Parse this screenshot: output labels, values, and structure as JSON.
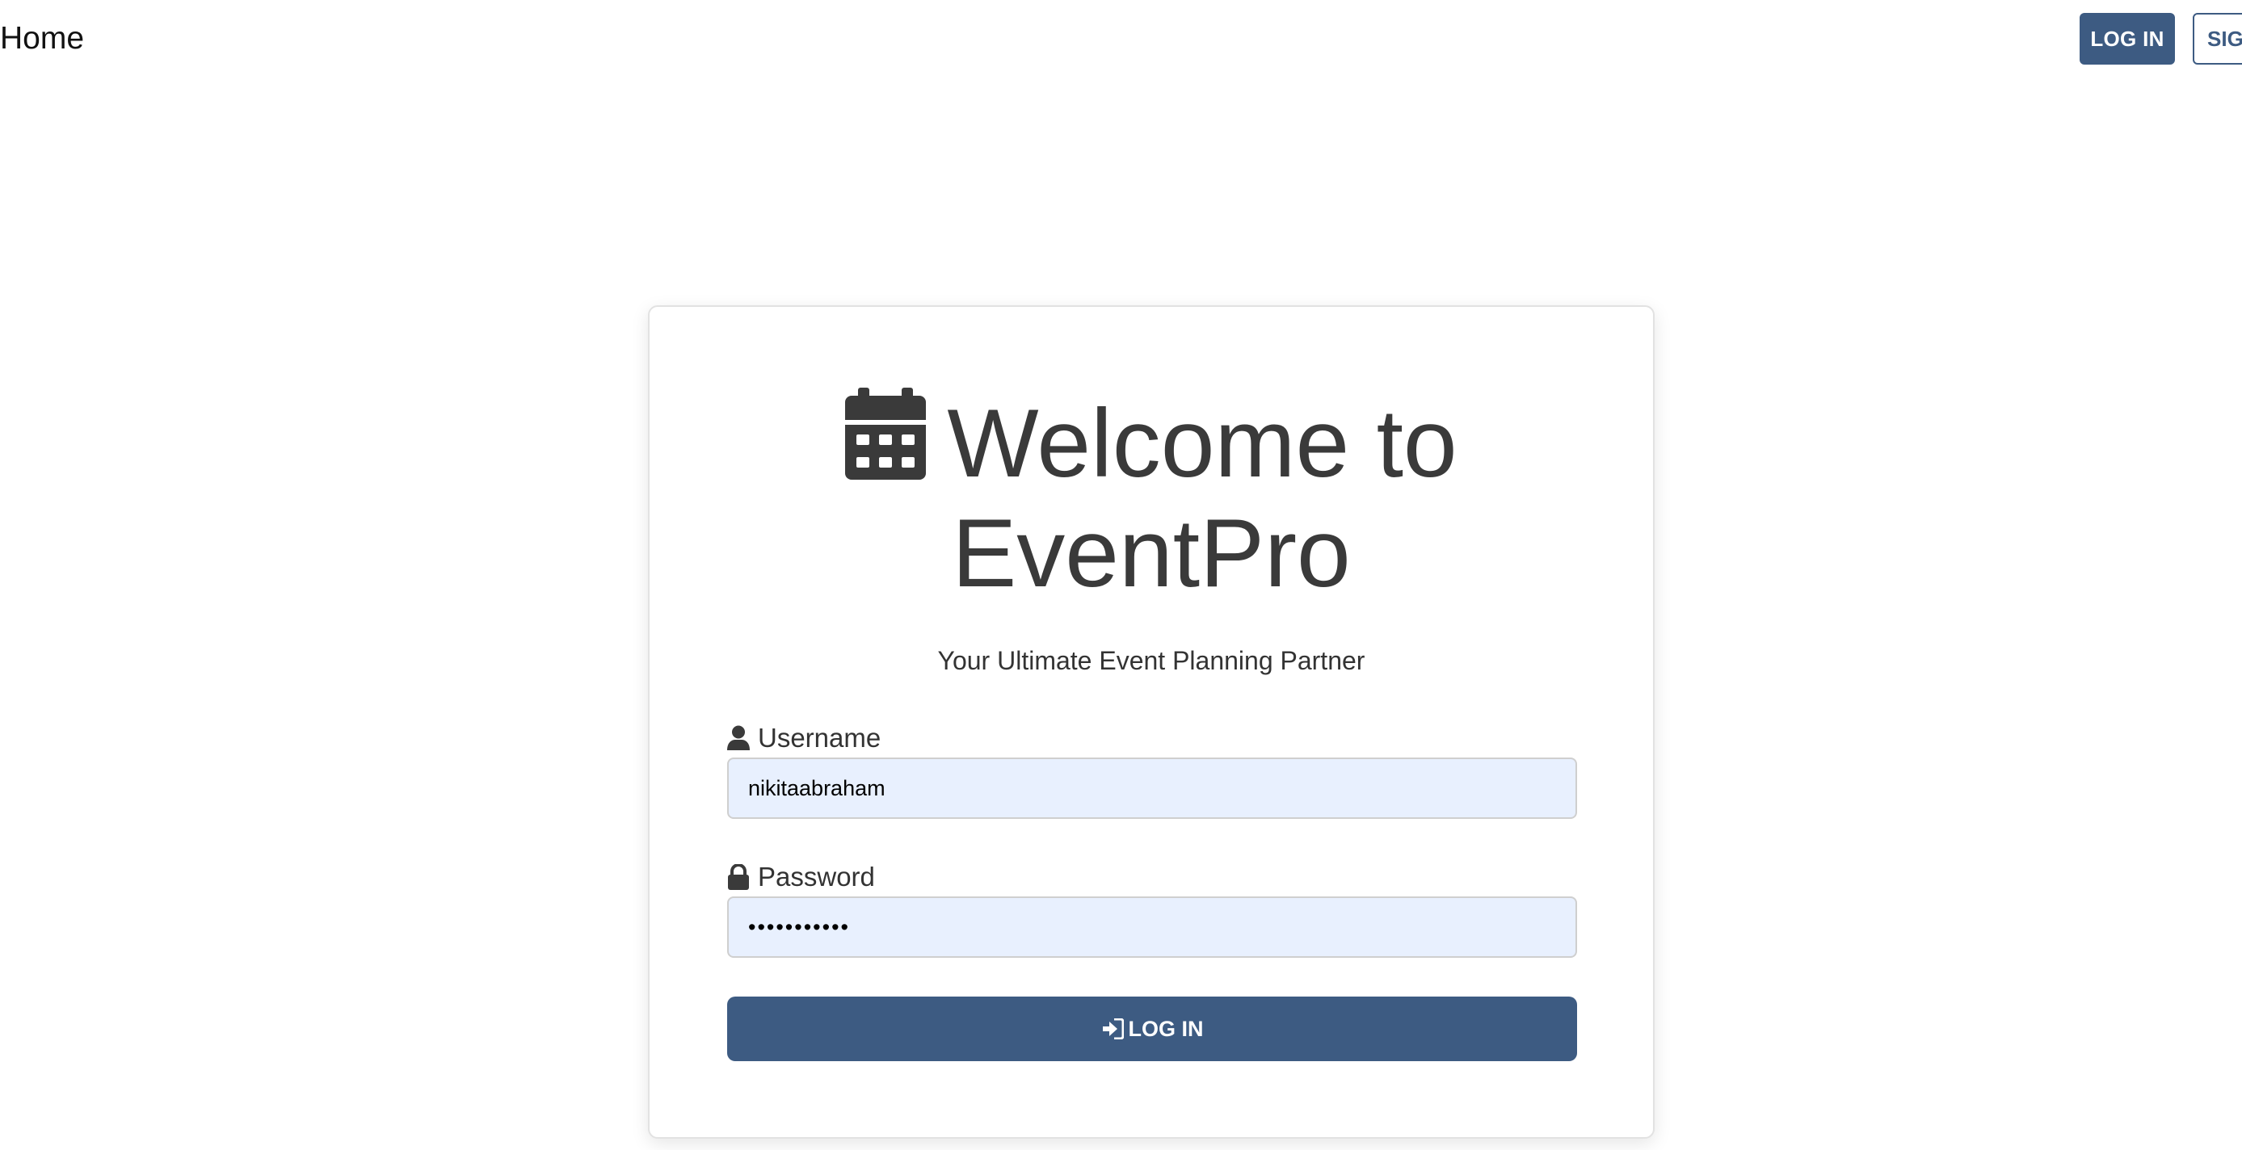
{
  "nav": {
    "home_label": "Home",
    "login_label": "LOG IN",
    "signup_label": "SIG"
  },
  "card": {
    "title_line1": "Welcome to",
    "title_line2": "EventPro",
    "subtitle": "Your Ultimate Event Planning Partner",
    "username": {
      "label": "Username",
      "value": "nikitaabraham"
    },
    "password": {
      "label": "Password",
      "value": "•••••••••••"
    },
    "submit_label": "LOG IN"
  },
  "icons": {
    "title_icon": "calendar-icon",
    "username_icon": "user-icon",
    "password_icon": "lock-icon",
    "submit_icon": "sign-in-icon"
  },
  "colors": {
    "primary": "#3d5b82",
    "input_bg": "#e8f0fe",
    "text": "#3a3a3a"
  }
}
